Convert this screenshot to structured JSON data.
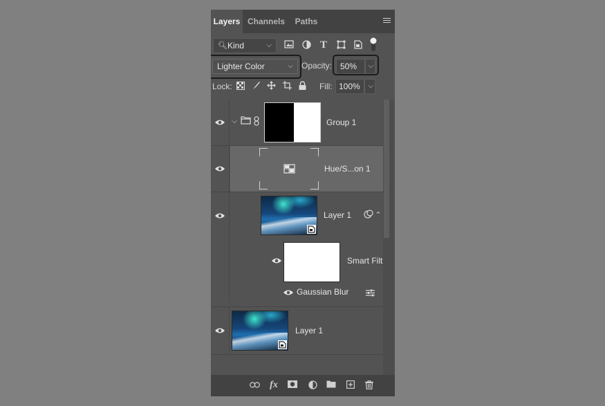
{
  "tabs": [
    {
      "label": "Layers",
      "active": true
    },
    {
      "label": "Channels",
      "active": false
    },
    {
      "label": "Paths",
      "active": false
    }
  ],
  "filter": {
    "kind_label": "Kind"
  },
  "blend": {
    "mode": "Lighter Color",
    "opacity_label": "Opacity:",
    "opacity_value": "50%"
  },
  "lock": {
    "label": "Lock:",
    "fill_label": "Fill:",
    "fill_value": "100%"
  },
  "layers": [
    {
      "name": "Group 1"
    },
    {
      "name": "Hue/S...on 1"
    },
    {
      "name": "Layer 1"
    },
    {
      "name": "Smart Filt"
    },
    {
      "name": "Gaussian Blur"
    },
    {
      "name": "Layer 1"
    }
  ],
  "colors": {
    "panel_bg": "#535353",
    "tab_bar_bg": "#424242",
    "selected_layer_bg": "#686868",
    "highlight_border": "#1b1b1b"
  }
}
